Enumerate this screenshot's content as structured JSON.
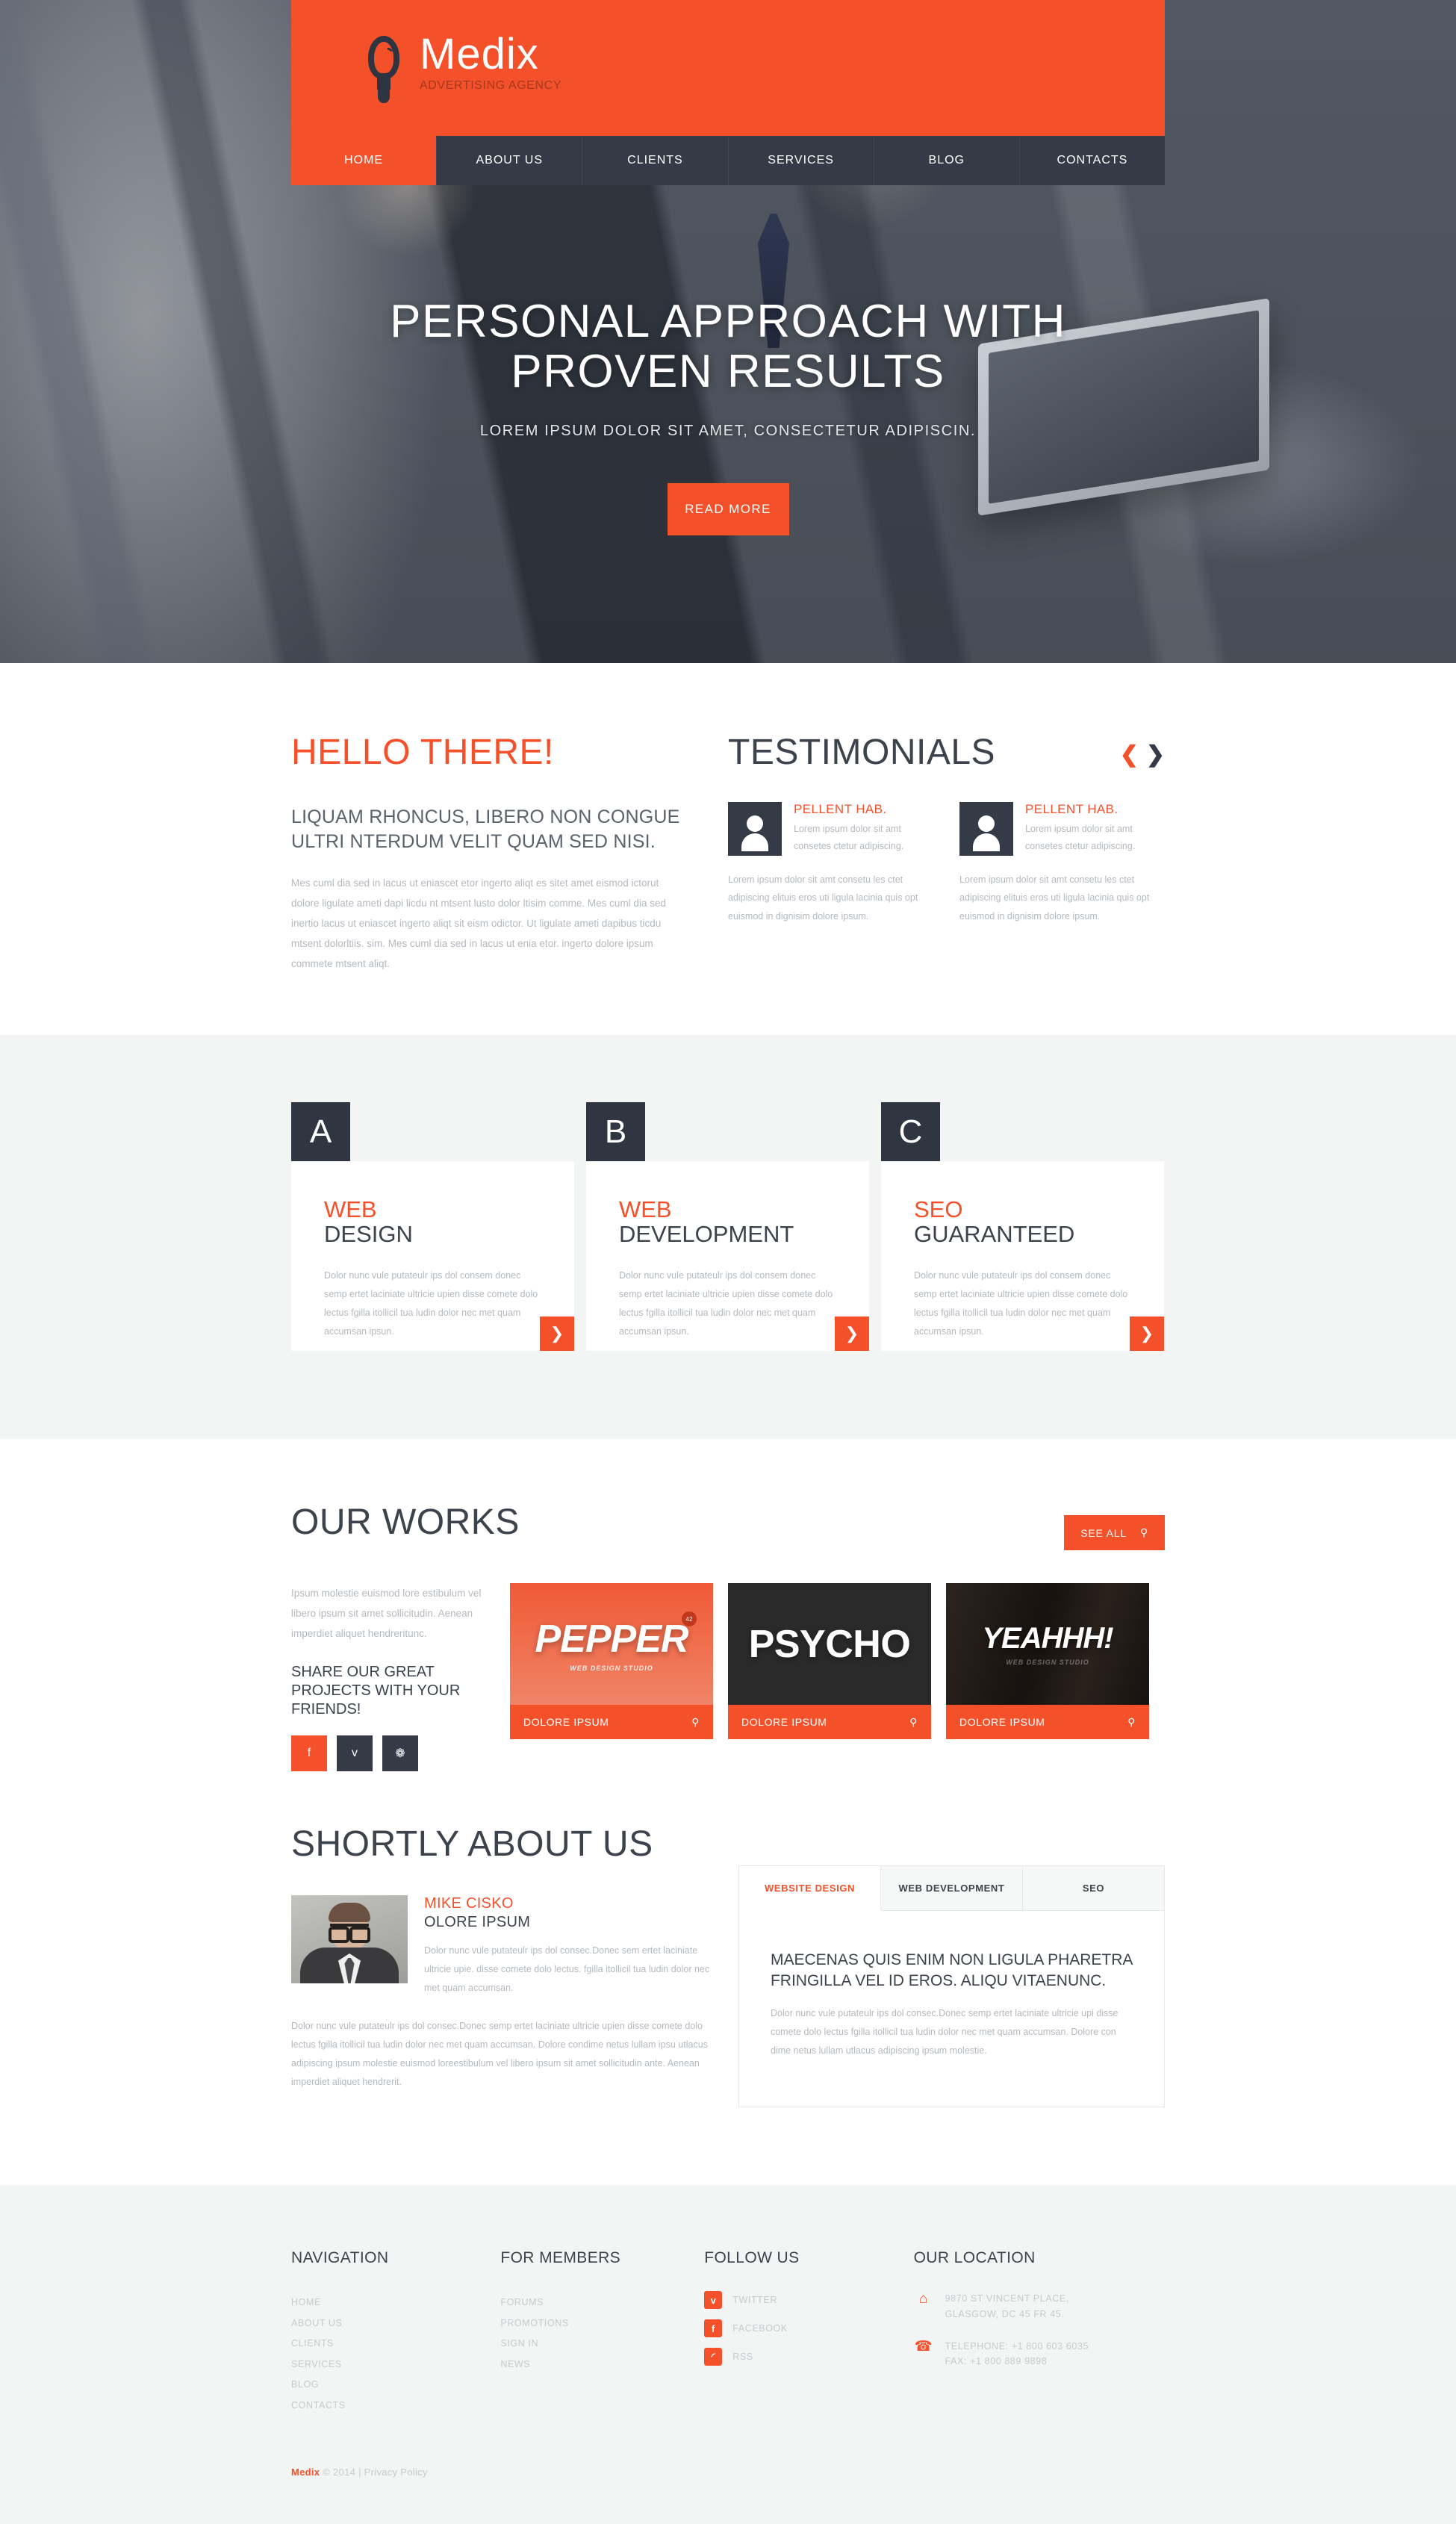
{
  "header": {
    "logo_name": "Medix",
    "logo_tagline": "ADVERTISING AGENCY",
    "logo_icon": "lightbulb-icon",
    "nav": [
      {
        "label": "HOME",
        "active": true
      },
      {
        "label": "ABOUT US",
        "active": false
      },
      {
        "label": "CLIENTS",
        "active": false
      },
      {
        "label": "SERVICES",
        "active": false
      },
      {
        "label": "BLOG",
        "active": false
      },
      {
        "label": "CONTACTS",
        "active": false
      }
    ]
  },
  "hero": {
    "title_line1": "PERSONAL APPROACH WITH",
    "title_line2": "PROVEN RESULTS",
    "subtitle": "LOREM IPSUM DOLOR SIT AMET, CONSECTETUR ADIPISCIN.",
    "button": "READ MORE"
  },
  "intro": {
    "heading": "HELLO THERE!",
    "lead": "LIQUAM RHONCUS, LIBERO NON CONGUE ULTRI NTERDUM VELIT QUAM SED NISI.",
    "body": "Mes cuml dia sed in lacus ut eniascet etor ingerto aliqt es sitet amet eismod ictorut dolore ligulate ameti dapi licdu nt mtsent lusto dolor ltisim comme. Mes cuml dia sed inertio lacus ut eniascet ingerto aliqt sit eism odictor. Ut ligulate ameti dapibus ticdu mtsent dolorltiis. sim. Mes cuml dia sed in lacus ut enia etor. ingerto dolore ipsum commete mtsent aliqt."
  },
  "testimonials": {
    "heading": "TESTIMONIALS",
    "prev_icon": "chevron-left-icon",
    "next_icon": "chevron-right-icon",
    "items": [
      {
        "name": "PELLENT HAB.",
        "quote": "Lorem ipsum dolor sit amt consetes ctetur adipiscing.",
        "text": "Lorem ipsum dolor sit amt consetu les ctet adipiscing elituis eros uti ligula lacinia quis opt euismod in dignisim dolore ipsum."
      },
      {
        "name": "PELLENT HAB.",
        "quote": "Lorem ipsum dolor sit amt consetes ctetur adipiscing.",
        "text": "Lorem ipsum dolor sit amt consetu les ctet adipiscing elituis eros uti ligula lacinia quis opt euismod in dignisim dolore ipsum."
      }
    ]
  },
  "services": [
    {
      "letter": "A",
      "title_accent": "WEB",
      "title_dark": "DESIGN",
      "body": "Dolor nunc vule putateulr ips dol consem donec semp ertet laciniate ultricie upien disse comete dolo lectus fgilla itollicil tua ludin dolor nec met quam accumsan ipsun.",
      "go_icon": "chevron-right-icon"
    },
    {
      "letter": "B",
      "title_accent": "WEB",
      "title_dark": "DEVELOPMENT",
      "body": "Dolor nunc vule putateulr ips dol consem donec semp ertet laciniate ultricie upien disse comete dolo lectus fgilla itollicil tua ludin dolor nec met quam accumsan ipsun.",
      "go_icon": "chevron-right-icon"
    },
    {
      "letter": "C",
      "title_accent": "SEO",
      "title_dark": "GUARANTEED",
      "body": "Dolor nunc vule putateulr ips dol consem donec semp ertet laciniate ultricie upien disse comete dolo lectus fgilla itollicil tua ludin dolor nec met quam accumsan ipsun.",
      "go_icon": "chevron-right-icon"
    }
  ],
  "works": {
    "heading": "OUR WORKS",
    "see_all": "SEE ALL",
    "see_all_icon": "search-icon",
    "intro": "Ipsum molestie euismod lore estibulum vel libero ipsum sit amet sollicitudin. Aenean imperdiet aliquet hendreritunc.",
    "share_title": "SHARE OUR GREAT PROJECTS WITH YOUR FRIENDS!",
    "socials": [
      {
        "name": "facebook-icon",
        "glyph": "f"
      },
      {
        "name": "twitter-icon",
        "glyph": "ᴠ"
      },
      {
        "name": "dribbble-icon",
        "glyph": "❁"
      }
    ],
    "items": [
      {
        "poster_main": "PEPPER",
        "poster_sub": "WEB DESIGN STUDIO",
        "badge": "42",
        "caption": "DOLORE IPSUM",
        "caption_icon": "search-icon"
      },
      {
        "poster_main": "PSYCHO",
        "poster_sub": "",
        "badge": "",
        "caption": "DOLORE IPSUM",
        "caption_icon": "search-icon"
      },
      {
        "poster_main": "YEAHHH!",
        "poster_sub": "WEB DESIGN STUDIO",
        "badge": "",
        "caption": "DOLORE IPSUM",
        "caption_icon": "search-icon"
      }
    ]
  },
  "about": {
    "heading": "SHORTLY ABOUT US",
    "person_name": "MIKE CISKO",
    "person_role": "OLORE IPSUM",
    "person_bio": "Dolor nunc vule putateulr ips dol consec.Donec sem ertet laciniate ultricie upie. disse comete dolo lectus. fgilla itollicil tua ludin dolor nec met quam accumsan.",
    "more": "Dolor nunc vule putateulr ips dol consec.Donec semp ertet laciniate ultricie upien disse comete dolo lectus fgilla itollicil tua ludin dolor nec met quam accumsan. Dolore condime netus lullam ipsu utlacus adipiscing ipsum molestie euismod loreestibulum vel libero ipsum sit amet sollicitudin ante. Aenean imperdiet aliquet hendrerit.",
    "tabs": [
      {
        "label": "WEBSITE DESIGN",
        "active": true
      },
      {
        "label": "WEB DEVELOPMENT",
        "active": false
      },
      {
        "label": "SEO",
        "active": false
      }
    ],
    "tab_title": "MAECENAS QUIS ENIM NON LIGULA PHARETRA FRINGILLA VEL ID EROS. ALIQU VITAENUNC.",
    "tab_text": "Dolor nunc vule putateulr ips dol consec.Donec semp ertet laciniate ultricie upi disse comete dolo lectus fgilla itollicil tua ludin dolor nec met quam accumsan. Dolore con dime netus lullam utlacus adipiscing ipsum molestie."
  },
  "footer": {
    "navigation": {
      "title": "NAVIGATION",
      "items": [
        "HOME",
        "ABOUT US",
        "CLIENTS",
        "SERVICES",
        "BLOG",
        "CONTACTS"
      ]
    },
    "members": {
      "title": "FOR MEMBERS",
      "items": [
        "FORUMS",
        "PROMOTIONS",
        "SIGN IN",
        "NEWS"
      ]
    },
    "follow": {
      "title": "FOLLOW US",
      "items": [
        {
          "label": "TWITTER",
          "icon": "twitter-icon",
          "glyph": "ᴠ"
        },
        {
          "label": "FACEBOOK",
          "icon": "facebook-icon",
          "glyph": "f"
        },
        {
          "label": "RSS",
          "icon": "rss-icon",
          "glyph": "◜"
        }
      ]
    },
    "location": {
      "title": "OUR LOCATION",
      "items": [
        {
          "icon": "home-icon",
          "glyph": "⌂",
          "line1": "9870 ST VINCENT PLACE,",
          "line2": "GLASGOW, DC 45 FR 45."
        },
        {
          "icon": "phone-icon",
          "glyph": "☎",
          "line1": "TELEPHONE: +1 800 603 6035",
          "line2": "FAX: +1 800 889 9898"
        }
      ]
    },
    "copyright_brand": "Medix",
    "copyright_rest": " © 2014 | Privacy Policy"
  },
  "colors": {
    "accent": "#f4502a",
    "dark": "#343b46",
    "gray_band": "#f3f5f5",
    "muted_text": "#b4b9bf"
  }
}
